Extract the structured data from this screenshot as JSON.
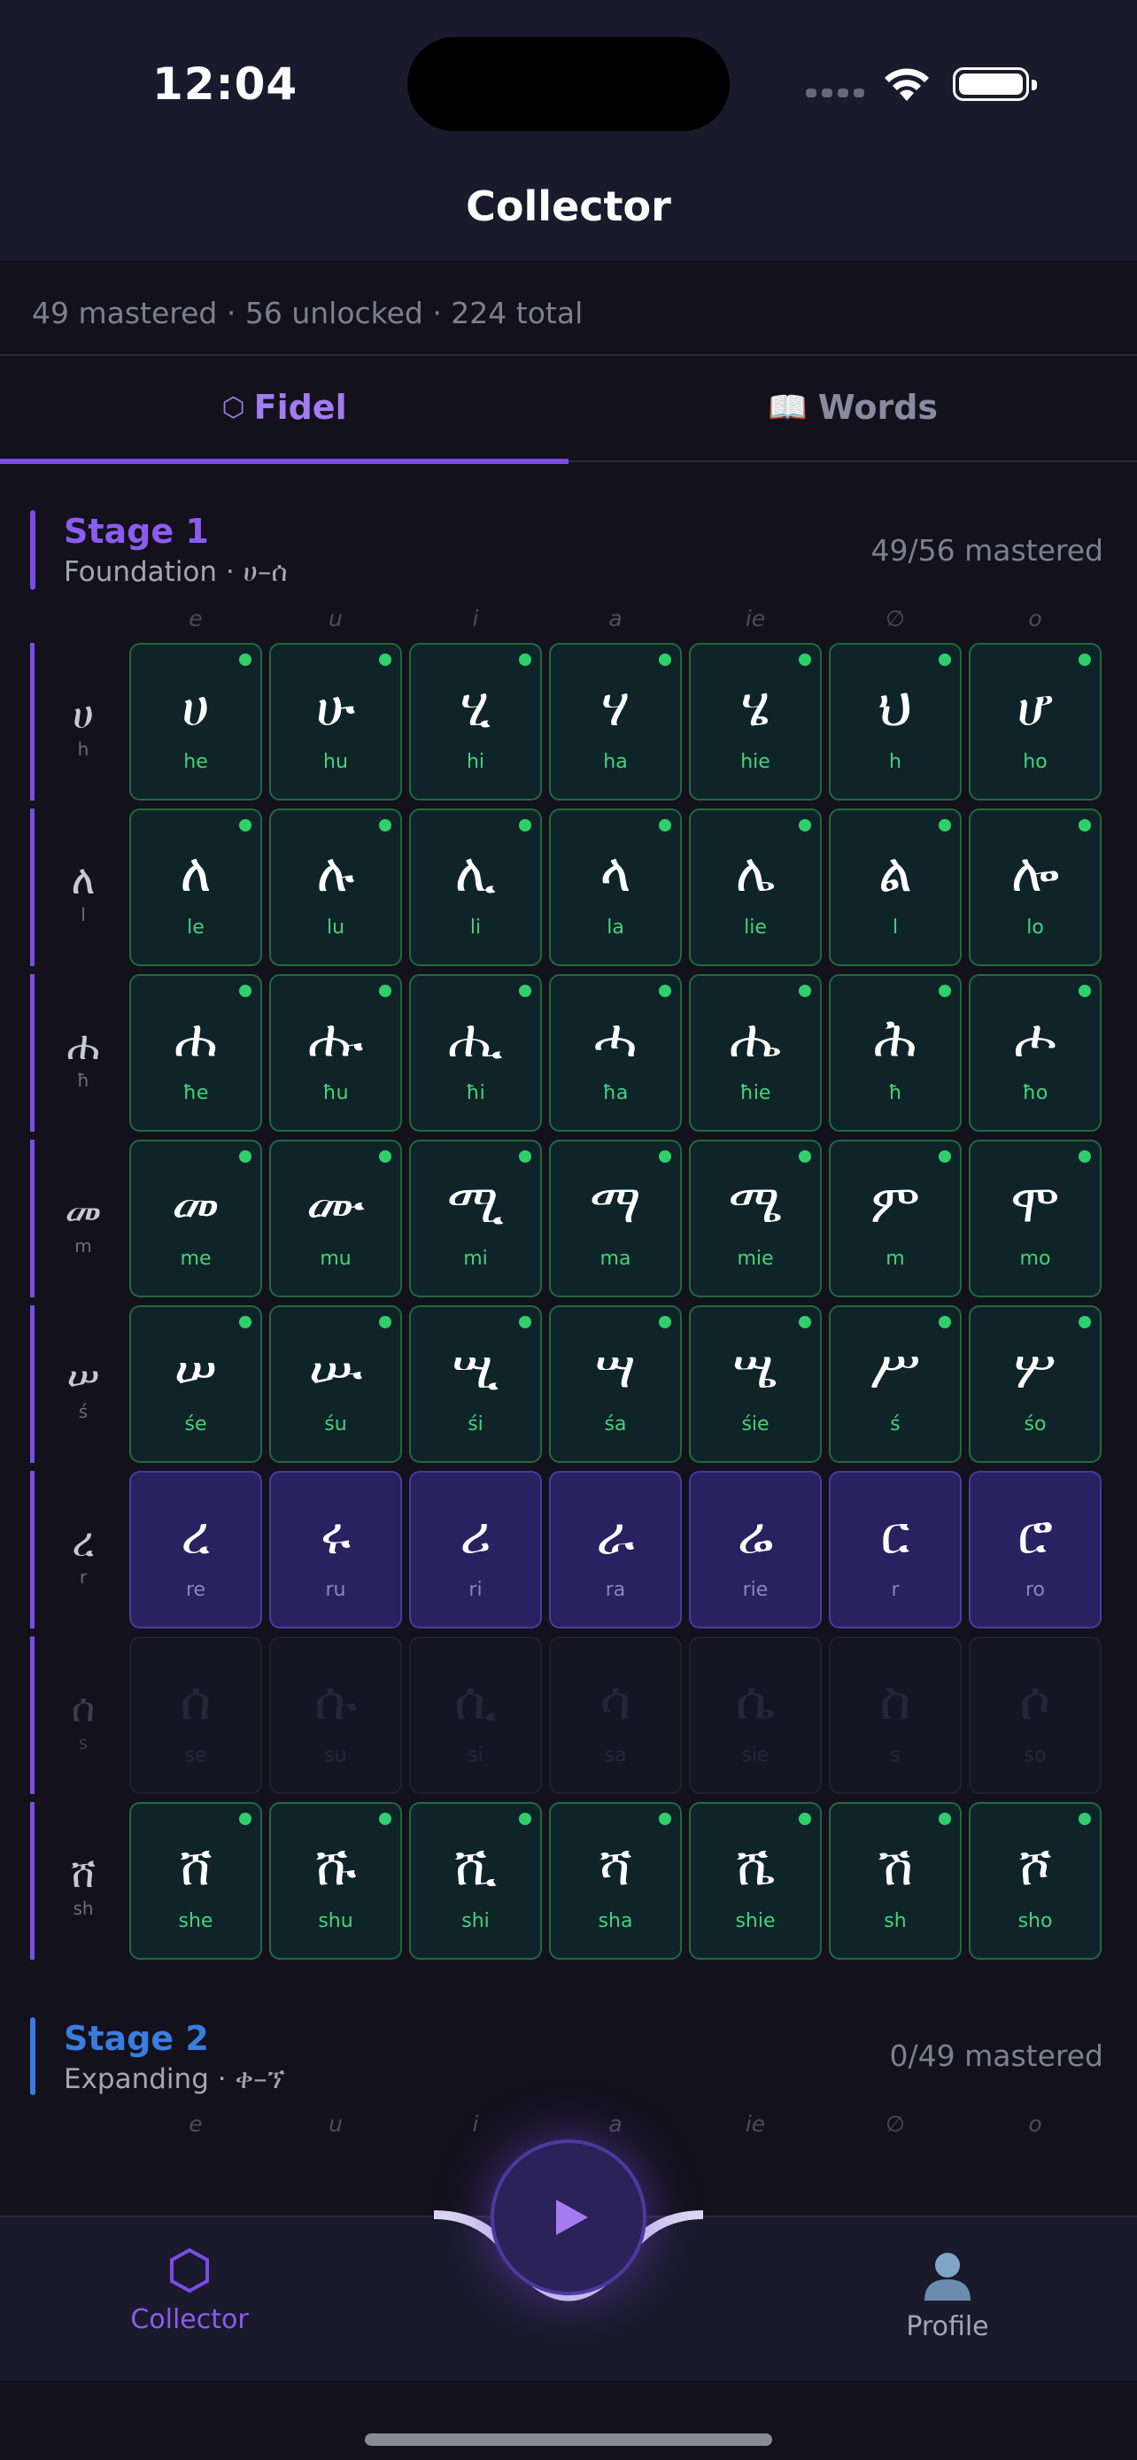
{
  "status": {
    "time": "12:04"
  },
  "header": {
    "title": "Collector"
  },
  "summary": "49 mastered · 56 unlocked · 224 total",
  "tabs": [
    {
      "icon": "⬡",
      "label": "Fidel"
    },
    {
      "icon": "📖",
      "label": "Words"
    }
  ],
  "vowels": [
    "e",
    "u",
    "i",
    "a",
    "ie",
    "∅",
    "o"
  ],
  "stage1": {
    "title": "Stage 1",
    "subtitle": "Foundation · ሀ–ሰ",
    "count": "49/56 mastered",
    "accent": "#7c4ce6",
    "rows": [
      {
        "glyph": "ሀ",
        "translit": "h",
        "state": "mastered",
        "cells": [
          [
            "ሀ",
            "he"
          ],
          [
            "ሁ",
            "hu"
          ],
          [
            "ሂ",
            "hi"
          ],
          [
            "ሃ",
            "ha"
          ],
          [
            "ሄ",
            "hie"
          ],
          [
            "ህ",
            "h"
          ],
          [
            "ሆ",
            "ho"
          ]
        ]
      },
      {
        "glyph": "ለ",
        "translit": "l",
        "state": "mastered",
        "cells": [
          [
            "ለ",
            "le"
          ],
          [
            "ሉ",
            "lu"
          ],
          [
            "ሊ",
            "li"
          ],
          [
            "ላ",
            "la"
          ],
          [
            "ሌ",
            "lie"
          ],
          [
            "ል",
            "l"
          ],
          [
            "ሎ",
            "lo"
          ]
        ]
      },
      {
        "glyph": "ሐ",
        "translit": "ħ",
        "state": "mastered",
        "cells": [
          [
            "ሐ",
            "ħe"
          ],
          [
            "ሑ",
            "ħu"
          ],
          [
            "ሒ",
            "ħi"
          ],
          [
            "ሓ",
            "ħa"
          ],
          [
            "ሔ",
            "ħie"
          ],
          [
            "ሕ",
            "ħ"
          ],
          [
            "ሖ",
            "ħo"
          ]
        ]
      },
      {
        "glyph": "መ",
        "translit": "m",
        "state": "mastered",
        "cells": [
          [
            "መ",
            "me"
          ],
          [
            "ሙ",
            "mu"
          ],
          [
            "ሚ",
            "mi"
          ],
          [
            "ማ",
            "ma"
          ],
          [
            "ሜ",
            "mie"
          ],
          [
            "ም",
            "m"
          ],
          [
            "ሞ",
            "mo"
          ]
        ]
      },
      {
        "glyph": "ሠ",
        "translit": "ś",
        "state": "mastered",
        "cells": [
          [
            "ሠ",
            "śe"
          ],
          [
            "ሡ",
            "śu"
          ],
          [
            "ሢ",
            "śi"
          ],
          [
            "ሣ",
            "śa"
          ],
          [
            "ሤ",
            "śie"
          ],
          [
            "ሥ",
            "ś"
          ],
          [
            "ሦ",
            "śo"
          ]
        ]
      },
      {
        "glyph": "ረ",
        "translit": "r",
        "state": "unlocked",
        "cells": [
          [
            "ረ",
            "re"
          ],
          [
            "ሩ",
            "ru"
          ],
          [
            "ሪ",
            "ri"
          ],
          [
            "ራ",
            "ra"
          ],
          [
            "ሬ",
            "rie"
          ],
          [
            "ር",
            "r"
          ],
          [
            "ሮ",
            "ro"
          ]
        ]
      },
      {
        "glyph": "ሰ",
        "translit": "s",
        "state": "locked",
        "cells": [
          [
            "ሰ",
            "se"
          ],
          [
            "ሱ",
            "su"
          ],
          [
            "ሲ",
            "si"
          ],
          [
            "ሳ",
            "sa"
          ],
          [
            "ሴ",
            "sie"
          ],
          [
            "ስ",
            "s"
          ],
          [
            "ሶ",
            "so"
          ]
        ]
      },
      {
        "glyph": "ሸ",
        "translit": "sh",
        "state": "mastered",
        "cells": [
          [
            "ሸ",
            "she"
          ],
          [
            "ሹ",
            "shu"
          ],
          [
            "ሺ",
            "shi"
          ],
          [
            "ሻ",
            "sha"
          ],
          [
            "ሼ",
            "shie"
          ],
          [
            "ሽ",
            "sh"
          ],
          [
            "ሾ",
            "sho"
          ]
        ]
      }
    ]
  },
  "stage2": {
    "title": "Stage 2",
    "subtitle": "Expanding · ቀ–ኘ",
    "count": "0/49 mastered",
    "accent": "#3a7ce0"
  },
  "nav": {
    "collector": {
      "icon": "hexagon-icon",
      "label": "Collector"
    },
    "profile": {
      "icon": "person-icon",
      "label": "Profile"
    },
    "play": {
      "icon": "play-icon"
    }
  }
}
